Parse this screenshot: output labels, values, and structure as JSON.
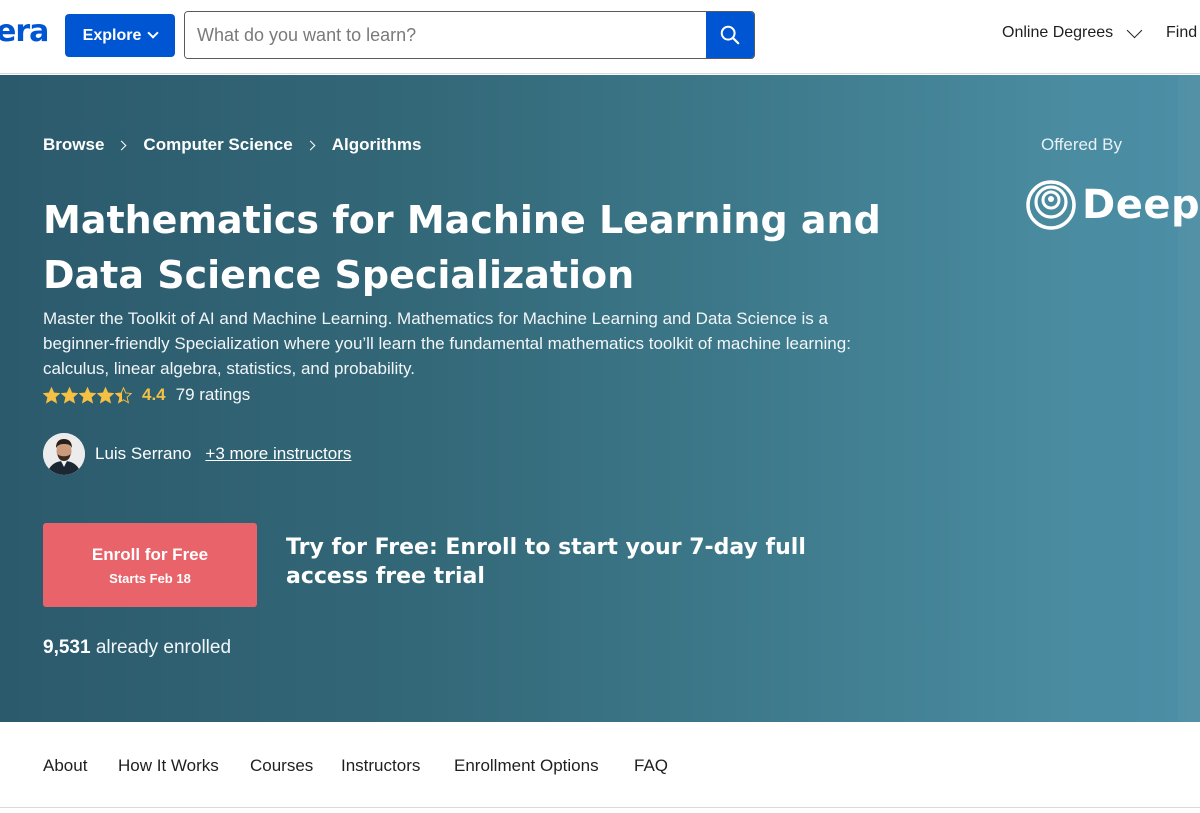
{
  "header": {
    "logo_fragment": "era",
    "explore_label": "Explore",
    "search_placeholder": "What do you want to learn?",
    "nav": {
      "online_degrees": "Online Degrees",
      "find": "Find"
    }
  },
  "breadcrumb": [
    "Browse",
    "Computer Science",
    "Algorithms"
  ],
  "partner": {
    "offered_by_label": "Offered By",
    "name": "Deepl"
  },
  "course": {
    "title": "Mathematics for Machine Learning and Data Science Specialization",
    "description": "Master the Toolkit of AI and Machine Learning. Mathematics for Machine Learning and Data Science is a beginner-friendly Specialization where you’ll learn the fundamental mathematics toolkit of machine learning: calculus, linear algebra, statistics, and probability.",
    "rating_value": "4.4",
    "rating_stars": 4.4,
    "rating_count": "79 ratings",
    "instructor_name": "Luis Serrano",
    "more_instructors": "+3 more instructors"
  },
  "enroll": {
    "button_label": "Enroll for Free",
    "start_date": "Starts Feb 18",
    "trial_text": "Try for Free: Enroll to start your 7-day full access free trial",
    "enrolled_count": "9,531",
    "enrolled_label": "already enrolled"
  },
  "tabs": [
    "About",
    "How It Works",
    "Courses",
    "Instructors",
    "Enrollment Options",
    "FAQ"
  ],
  "colors": {
    "brand_blue": "#0056d2",
    "enroll_red": "#e8636a",
    "star_gold": "#f5c043",
    "hero_start": "#2b5a6c",
    "hero_end": "#4b8fa6"
  }
}
